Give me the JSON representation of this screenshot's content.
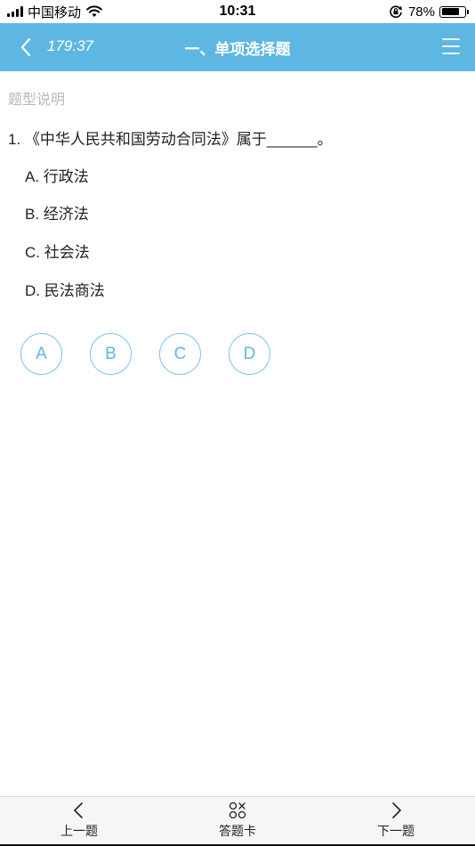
{
  "status_bar": {
    "carrier": "中国移动",
    "time": "10:31",
    "battery_percent": "78%",
    "battery_level": 0.78
  },
  "nav": {
    "timer": "179:37",
    "title": "一、单项选择题"
  },
  "content": {
    "type_note": "题型说明",
    "question": "1. 《中华人民共和国劳动合同法》属于______。",
    "options": [
      {
        "label": "A. 行政法"
      },
      {
        "label": "B. 经济法"
      },
      {
        "label": "C. 社会法"
      },
      {
        "label": "D. 民法商法"
      }
    ],
    "answer_buttons": [
      "A",
      "B",
      "C",
      "D"
    ]
  },
  "toolbar": {
    "prev_label": "上一题",
    "card_label": "答题卡",
    "next_label": "下一题"
  },
  "colors": {
    "accent": "#5eb7e2",
    "hint_gray": "#b8b8b8"
  },
  "icons": {
    "back": "chevron-left-icon",
    "menu": "hamburger-menu-icon",
    "prev": "chevron-left-icon",
    "card": "answer-card-icon",
    "next": "chevron-right-icon"
  }
}
